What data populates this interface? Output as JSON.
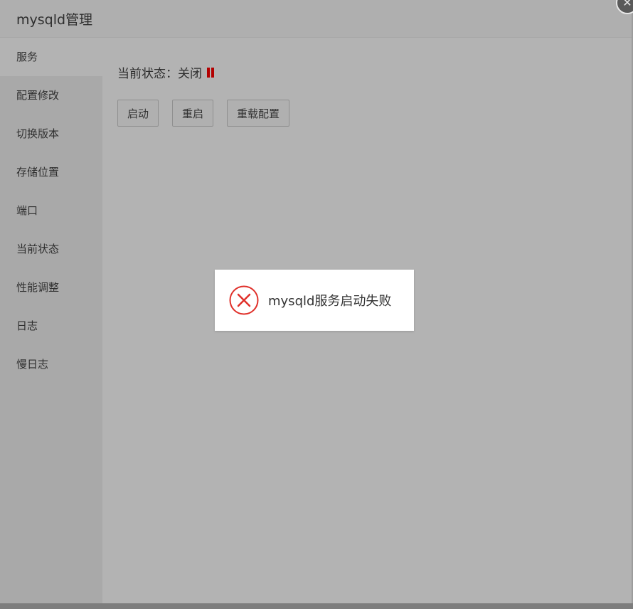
{
  "window": {
    "title": "mysqld管理",
    "close_glyph": "✕"
  },
  "sidebar": {
    "items": [
      {
        "label": "服务",
        "active": true
      },
      {
        "label": "配置修改"
      },
      {
        "label": "切换版本"
      },
      {
        "label": "存储位置"
      },
      {
        "label": "端口"
      },
      {
        "label": "当前状态"
      },
      {
        "label": "性能调整"
      },
      {
        "label": "日志"
      },
      {
        "label": "慢日志"
      }
    ]
  },
  "service": {
    "status_text": "当前状态：关闭",
    "status_icon": "pause-icon",
    "status_color": "#b30000",
    "buttons": {
      "start": "启动",
      "restart": "重启",
      "reload": "重载配置"
    }
  },
  "toast": {
    "icon": "error-circle-icon",
    "icon_color": "#e0302a",
    "message": "mysqld服务启动失败"
  }
}
